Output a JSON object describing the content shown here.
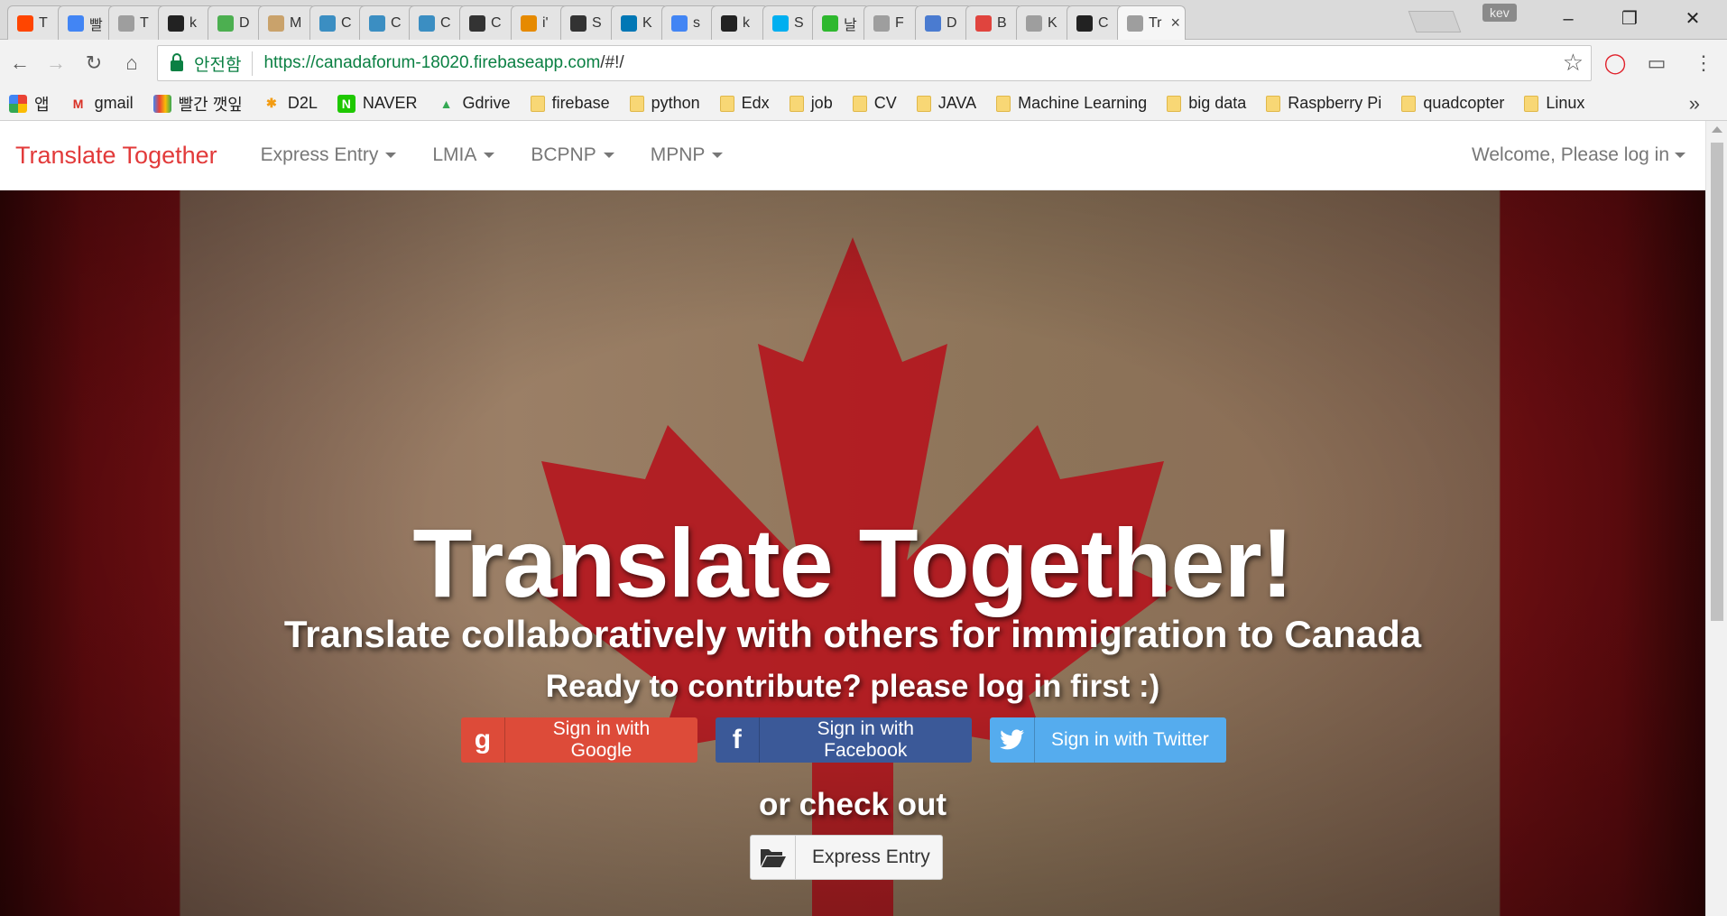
{
  "browser": {
    "tabs": [
      {
        "label": "T",
        "icon": "reddit-icon",
        "color": "#ff4500"
      },
      {
        "label": "빨",
        "icon": "color-bars-icon",
        "color": "#4285f4"
      },
      {
        "label": "T",
        "icon": "page-icon",
        "color": "#9e9e9e"
      },
      {
        "label": "k",
        "icon": "github-icon",
        "color": "#222222"
      },
      {
        "label": "D",
        "icon": "image-icon",
        "color": "#4caf50"
      },
      {
        "label": "M",
        "icon": "hand-icon",
        "color": "#c9a26b"
      },
      {
        "label": "C",
        "icon": "codeschool-icon",
        "color": "#3b8ec2"
      },
      {
        "label": "C",
        "icon": "codeschool-icon",
        "color": "#3b8ec2"
      },
      {
        "label": "C",
        "icon": "codeschool-icon",
        "color": "#3b8ec2"
      },
      {
        "label": "C",
        "icon": "ghost-icon",
        "color": "#333333"
      },
      {
        "label": "i'",
        "icon": "wr-icon",
        "color": "#e68a00"
      },
      {
        "label": "S",
        "icon": "ghost-icon",
        "color": "#333333"
      },
      {
        "label": "K",
        "icon": "linkedin-icon",
        "color": "#0077b5"
      },
      {
        "label": "s",
        "icon": "google-icon",
        "color": "#4285f4"
      },
      {
        "label": "k",
        "icon": "github-icon",
        "color": "#222222"
      },
      {
        "label": "S",
        "icon": "skype-icon",
        "color": "#00aff0"
      },
      {
        "label": "날",
        "icon": "mail-icon",
        "color": "#2eb82e"
      },
      {
        "label": "F",
        "icon": "page-icon",
        "color": "#9e9e9e"
      },
      {
        "label": "D",
        "icon": "infinity-icon",
        "color": "#4a7bd0"
      },
      {
        "label": "B",
        "icon": "bookmark-icon",
        "color": "#e0443e"
      },
      {
        "label": "K",
        "icon": "page-icon",
        "color": "#9e9e9e"
      },
      {
        "label": "C",
        "icon": "github-icon",
        "color": "#222222"
      },
      {
        "label": "Tr",
        "icon": "page-icon",
        "color": "#9e9e9e",
        "active": true
      }
    ],
    "profile_name": "kev",
    "url_host": "https://canadaforum-18020.firebaseapp.com",
    "url_rest": "/#!/",
    "secure_label": "안전함",
    "bookmarks": [
      {
        "label": "앱",
        "icon": "apps-icon"
      },
      {
        "label": "gmail",
        "icon": "gmail-icon"
      },
      {
        "label": "빨간 깻잎",
        "icon": "color-bars-icon"
      },
      {
        "label": "D2L",
        "icon": "d2l-icon"
      },
      {
        "label": "NAVER",
        "icon": "naver-icon"
      },
      {
        "label": "Gdrive",
        "icon": "gdrive-icon"
      },
      {
        "label": "firebase",
        "icon": "folder-icon"
      },
      {
        "label": "python",
        "icon": "folder-icon"
      },
      {
        "label": "Edx",
        "icon": "folder-icon"
      },
      {
        "label": "job",
        "icon": "folder-icon"
      },
      {
        "label": "CV",
        "icon": "folder-icon"
      },
      {
        "label": "JAVA",
        "icon": "folder-icon"
      },
      {
        "label": "Machine Learning",
        "icon": "folder-icon"
      },
      {
        "label": "big data",
        "icon": "folder-icon"
      },
      {
        "label": "Raspberry Pi",
        "icon": "folder-icon"
      },
      {
        "label": "quadcopter",
        "icon": "folder-icon"
      },
      {
        "label": "Linux",
        "icon": "folder-icon"
      }
    ],
    "more_bookmarks": "»"
  },
  "navbar": {
    "brand": "Translate Together",
    "items": [
      "Express Entry",
      "LMIA",
      "BCPNP",
      "MPNP"
    ],
    "welcome": "Welcome, Please log in"
  },
  "hero": {
    "title": "Translate Together!",
    "subtitle": "Translate collaboratively with others for immigration to Canada",
    "prompt": "Ready to contribute? please log in first :)",
    "google_label": "Sign in with Google",
    "facebook_label": "Sign in with Facebook",
    "twitter_label": "Sign in with Twitter",
    "or_text": "or check out",
    "express_label": "Express Entry"
  },
  "colors": {
    "brand": "#e23a3a",
    "google": "#dd4b39",
    "facebook": "#3b5998",
    "twitter": "#55acee",
    "flag_red": "#b5121b"
  }
}
